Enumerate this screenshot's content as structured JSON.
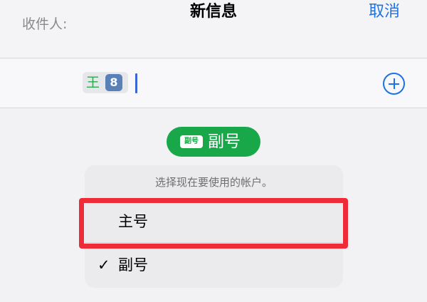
{
  "header": {
    "title": "新信息",
    "cancel_label": "取消"
  },
  "recipient": {
    "label": "收件人:",
    "chip_name": "王",
    "chip_number": "8",
    "add_icon": "plus-circle-icon"
  },
  "account_pill": {
    "badge": "副号",
    "label": "副号",
    "color": "#18a84a"
  },
  "menu": {
    "header": "选择现在要使用的帐户。",
    "items": [
      {
        "label": "主号",
        "selected": false,
        "highlighted": true
      },
      {
        "label": "副号",
        "selected": true,
        "highlighted": false
      }
    ],
    "checkmark": "✓"
  },
  "colors": {
    "accent": "#1a73e8",
    "highlight": "#ee2b36",
    "contact_name": "#2fa84f"
  }
}
